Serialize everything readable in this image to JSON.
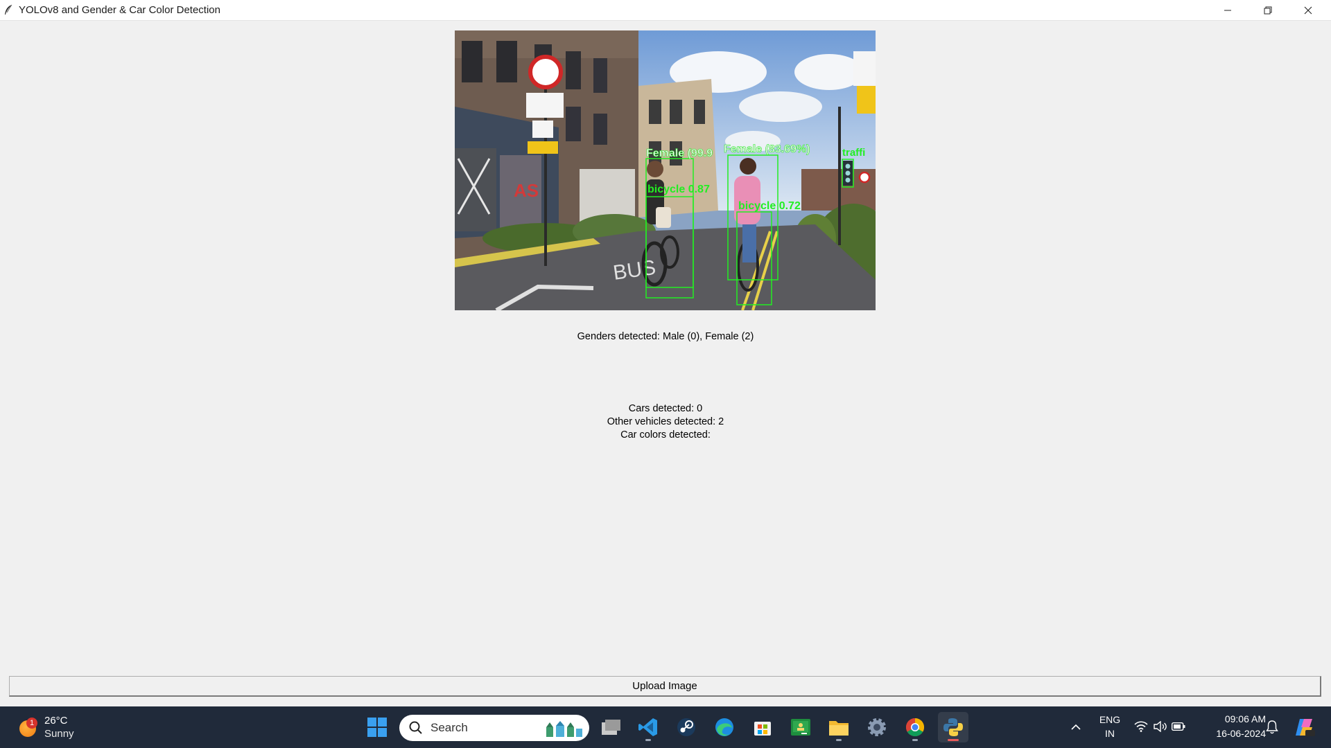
{
  "window": {
    "title": "YOLOv8 and Gender & Car Color Detection"
  },
  "image": {
    "detections": [
      {
        "label": "Female (99.9",
        "color": "#22ee22"
      },
      {
        "label": "Female (83.69%)",
        "color": "#22ee22"
      },
      {
        "label": "traffi",
        "color": "#22ee22"
      },
      {
        "label": "bicycle 0.87",
        "color": "#22ee22"
      },
      {
        "label": "bicycle 0.72",
        "color": "#22ee22"
      }
    ]
  },
  "results": {
    "genders": "Genders detected: Male (0), Female (2)",
    "cars": "Cars detected: 0",
    "other_vehicles": "Other vehicles detected: 2",
    "car_colors": "Car colors detected:"
  },
  "upload_button": "Upload Image",
  "taskbar": {
    "weather": {
      "temp": "26°C",
      "condition": "Sunny",
      "badge": "1"
    },
    "search_placeholder": "Search",
    "language": {
      "line1": "ENG",
      "line2": "IN"
    },
    "clock": {
      "time": "09:06 AM",
      "date": "16-06-2024"
    },
    "pinned_apps": [
      "start-icon",
      "task-view-icon",
      "vscode-icon",
      "steam-icon",
      "edge-icon",
      "store-icon",
      "classroom-icon",
      "file-explorer-icon",
      "settings-icon",
      "chrome-icon",
      "python-icon"
    ]
  }
}
